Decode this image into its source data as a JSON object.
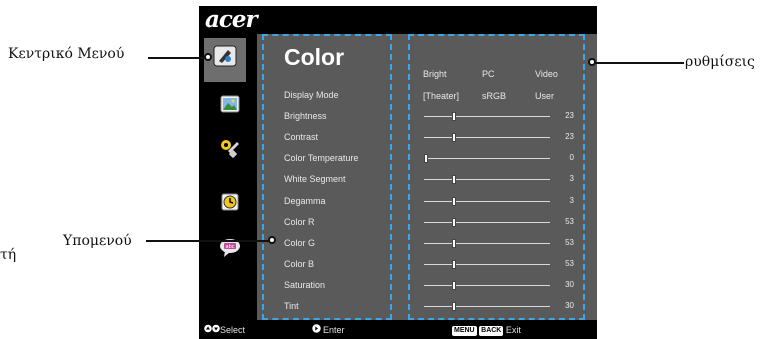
{
  "brand": "acer",
  "menu": {
    "title": "Color",
    "items": [
      {
        "label": "Display Mode",
        "type": "options"
      },
      {
        "label": "Brightness",
        "type": "slider",
        "value": "23",
        "level": 0.23
      },
      {
        "label": "Contrast",
        "type": "slider",
        "value": "23",
        "level": 0.23
      },
      {
        "label": "Color Temperature",
        "type": "slider",
        "value": "0",
        "level": 0.0
      },
      {
        "label": "White Segment",
        "type": "slider",
        "value": "3",
        "level": 0.23
      },
      {
        "label": "Degamma",
        "type": "slider",
        "value": "3",
        "level": 0.23
      },
      {
        "label": "Color R",
        "type": "slider",
        "value": "53",
        "level": 0.23
      },
      {
        "label": "Color G",
        "type": "slider",
        "value": "53",
        "level": 0.23
      },
      {
        "label": "Color B",
        "type": "slider",
        "value": "53",
        "level": 0.23
      },
      {
        "label": "Saturation",
        "type": "slider",
        "value": "30",
        "level": 0.23
      },
      {
        "label": "Tint",
        "type": "slider",
        "value": "30",
        "level": 0.23
      }
    ],
    "mode_headers": [
      "Bright",
      "PC",
      "Video"
    ],
    "mode_values": [
      "[Theater]",
      "sRGB",
      "User"
    ]
  },
  "sidebar_icons": [
    "color-icon",
    "image-icon",
    "settings-icon",
    "timer-icon",
    "language-icon"
  ],
  "footer": {
    "select": "Select",
    "enter": "Enter",
    "menu_badge": "MENU",
    "back_badge": "BACK",
    "exit": "Exit"
  },
  "callouts": {
    "main_menu": "Κεντρικό Μενού",
    "submenu": "Υπομενού",
    "settings": "ρυθμίσεις",
    "cut_text": "τή"
  },
  "colors": {
    "accent_dash": "#3aa7e6",
    "panel": "#5a5a5a",
    "frame": "#000000"
  }
}
